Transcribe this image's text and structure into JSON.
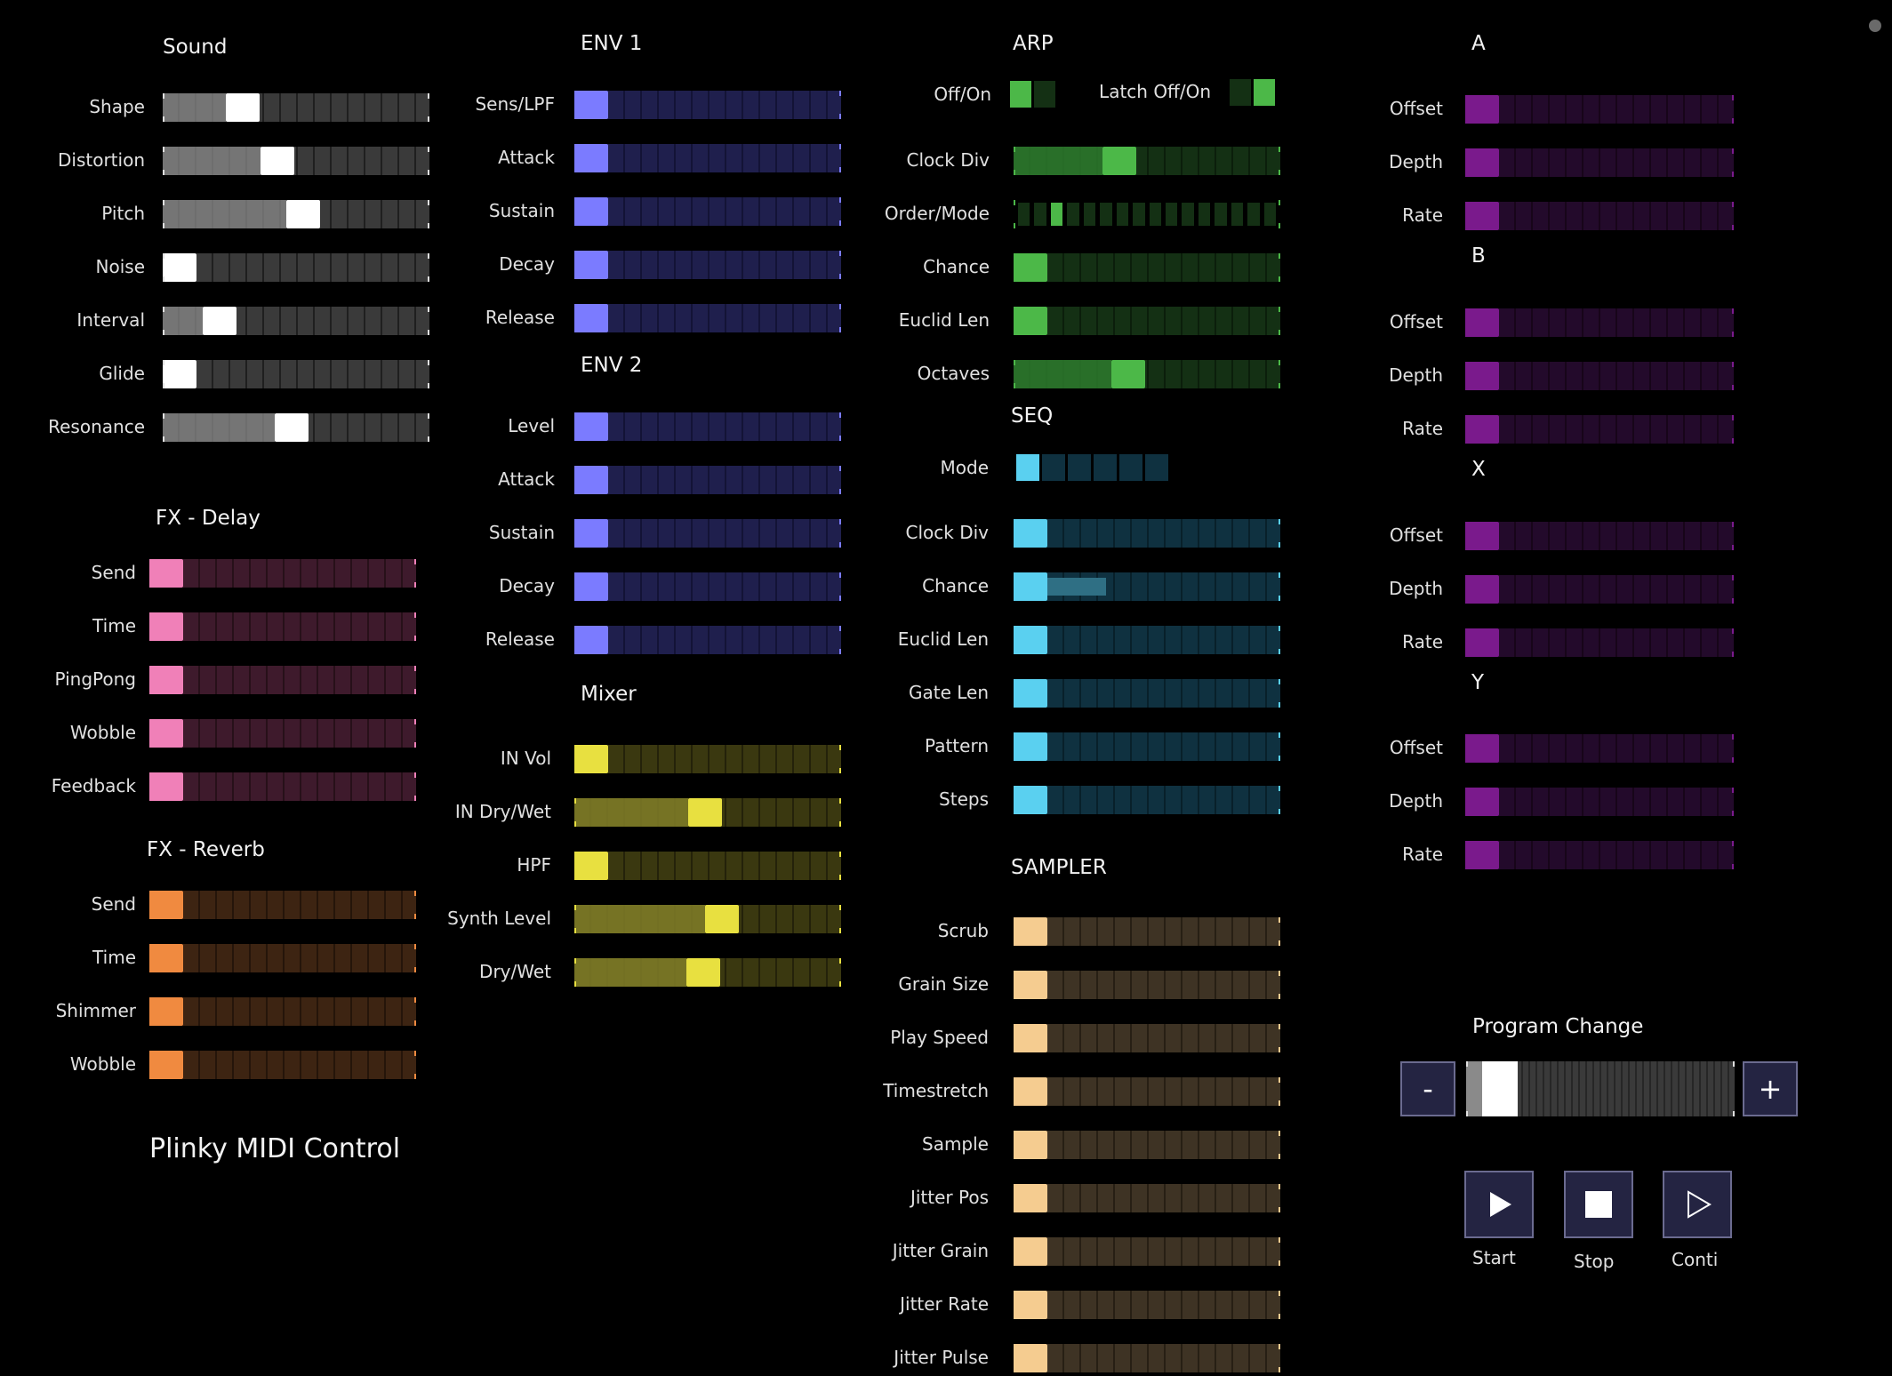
{
  "app": {
    "title": "Plinky MIDI Control"
  },
  "colors": {
    "sound": "#a8a8a8",
    "delay": "#f080b8",
    "reverb": "#f08a40",
    "env": "#7b7bff",
    "mixer": "#e8e040",
    "arp": "#4cb848",
    "seq": "#5ad0f0",
    "sampler": "#f5cc90",
    "mod": "#7a1a8c",
    "program": "#9a9a9a"
  },
  "sections": {
    "sound": {
      "title": "Sound",
      "theme": "sound",
      "params": [
        {
          "label": "Shape",
          "value": 0.27
        },
        {
          "label": "Distortion",
          "value": 0.42
        },
        {
          "label": "Pitch",
          "value": 0.53
        },
        {
          "label": "Noise",
          "value": 0.0
        },
        {
          "label": "Interval",
          "value": 0.17
        },
        {
          "label": "Glide",
          "value": 0.0
        },
        {
          "label": "Resonance",
          "value": 0.48
        }
      ]
    },
    "fx_delay": {
      "title": "FX - Delay",
      "theme": "delay",
      "params": [
        {
          "label": "Send",
          "value": 0.0
        },
        {
          "label": "Time",
          "value": 0.0
        },
        {
          "label": "PingPong",
          "value": 0.0
        },
        {
          "label": "Wobble",
          "value": 0.0
        },
        {
          "label": "Feedback",
          "value": 0.0
        }
      ]
    },
    "fx_reverb": {
      "title": "FX - Reverb",
      "theme": "reverb",
      "params": [
        {
          "label": "Send",
          "value": 0.0
        },
        {
          "label": "Time",
          "value": 0.0
        },
        {
          "label": "Shimmer",
          "value": 0.0
        },
        {
          "label": "Wobble",
          "value": 0.0
        }
      ]
    },
    "env1": {
      "title": "ENV 1",
      "theme": "env",
      "params": [
        {
          "label": "Sens/LPF",
          "value": 0.0
        },
        {
          "label": "Attack",
          "value": 0.0
        },
        {
          "label": "Sustain",
          "value": 0.0
        },
        {
          "label": "Decay",
          "value": 0.0
        },
        {
          "label": "Release",
          "value": 0.0
        }
      ]
    },
    "env2": {
      "title": "ENV 2",
      "theme": "env",
      "params": [
        {
          "label": "Level",
          "value": 0.0
        },
        {
          "label": "Attack",
          "value": 0.0
        },
        {
          "label": "Sustain",
          "value": 0.0
        },
        {
          "label": "Decay",
          "value": 0.0
        },
        {
          "label": "Release",
          "value": 0.0
        }
      ]
    },
    "mixer": {
      "title": "Mixer",
      "theme": "mixer",
      "params": [
        {
          "label": "IN Vol",
          "value": 0.0
        },
        {
          "label": "IN Dry/Wet",
          "value": 0.49
        },
        {
          "label": "HPF",
          "value": 0.0
        },
        {
          "label": "Synth Level",
          "value": 0.56
        },
        {
          "label": "Dry/Wet",
          "value": 0.48
        }
      ]
    },
    "arp": {
      "title": "ARP",
      "theme": "arp",
      "offon_label": "Off/On",
      "offon_value": 0,
      "latch_label": "Latch Off/On",
      "latch_value": 1,
      "params": [
        {
          "label": "Clock Div",
          "value": 0.38
        },
        {
          "label": "Order/Mode",
          "value": 0.16,
          "style": "steps",
          "steps": 16
        },
        {
          "label": "Chance",
          "value": 0.0
        },
        {
          "label": "Euclid Len",
          "value": 0.0
        },
        {
          "label": "Octaves",
          "value": 0.42
        }
      ]
    },
    "seq": {
      "title": "SEQ",
      "theme": "seq",
      "mode_label": "Mode",
      "mode_value": 0,
      "mode_count": 6,
      "params": [
        {
          "label": "Clock Div",
          "value": 0.0
        },
        {
          "label": "Chance",
          "value": 0.0,
          "bar": 0.5
        },
        {
          "label": "Euclid Len",
          "value": 0.0
        },
        {
          "label": "Gate Len",
          "value": 0.0
        },
        {
          "label": "Pattern",
          "value": 0.0
        },
        {
          "label": "Steps",
          "value": 0.0
        }
      ]
    },
    "sampler": {
      "title": "SAMPLER",
      "theme": "sampler",
      "params": [
        {
          "label": "Scrub",
          "value": 0.0
        },
        {
          "label": "Grain Size",
          "value": 0.0
        },
        {
          "label": "Play Speed",
          "value": 0.0
        },
        {
          "label": "Timestretch",
          "value": 0.0
        },
        {
          "label": "Sample",
          "value": 0.0
        },
        {
          "label": "Jitter Pos",
          "value": 0.0
        },
        {
          "label": "Jitter Grain",
          "value": 0.0
        },
        {
          "label": "Jitter Rate",
          "value": 0.0
        },
        {
          "label": "Jitter Pulse",
          "value": 0.0
        }
      ]
    },
    "mod_a": {
      "title": "A",
      "theme": "mod",
      "params": [
        {
          "label": "Offset",
          "value": 0.0
        },
        {
          "label": "Depth",
          "value": 0.0
        },
        {
          "label": "Rate",
          "value": 0.0
        }
      ]
    },
    "mod_b": {
      "title": "B",
      "theme": "mod",
      "params": [
        {
          "label": "Offset",
          "value": 0.0
        },
        {
          "label": "Depth",
          "value": 0.0
        },
        {
          "label": "Rate",
          "value": 0.0
        }
      ]
    },
    "mod_x": {
      "title": "X",
      "theme": "mod",
      "params": [
        {
          "label": "Offset",
          "value": 0.0
        },
        {
          "label": "Depth",
          "value": 0.0
        },
        {
          "label": "Rate",
          "value": 0.0
        }
      ]
    },
    "mod_y": {
      "title": "Y",
      "theme": "mod",
      "params": [
        {
          "label": "Offset",
          "value": 0.0
        },
        {
          "label": "Depth",
          "value": 0.0
        },
        {
          "label": "Rate",
          "value": 0.0
        }
      ]
    }
  },
  "program_change": {
    "title": "Program Change",
    "value": 0.07,
    "minus_label": "-",
    "plus_label": "+"
  },
  "transport": [
    {
      "label": "Start",
      "icon": "play-icon"
    },
    {
      "label": "Stop",
      "icon": "stop-icon"
    },
    {
      "label": "Conti",
      "icon": "continue-icon"
    }
  ]
}
